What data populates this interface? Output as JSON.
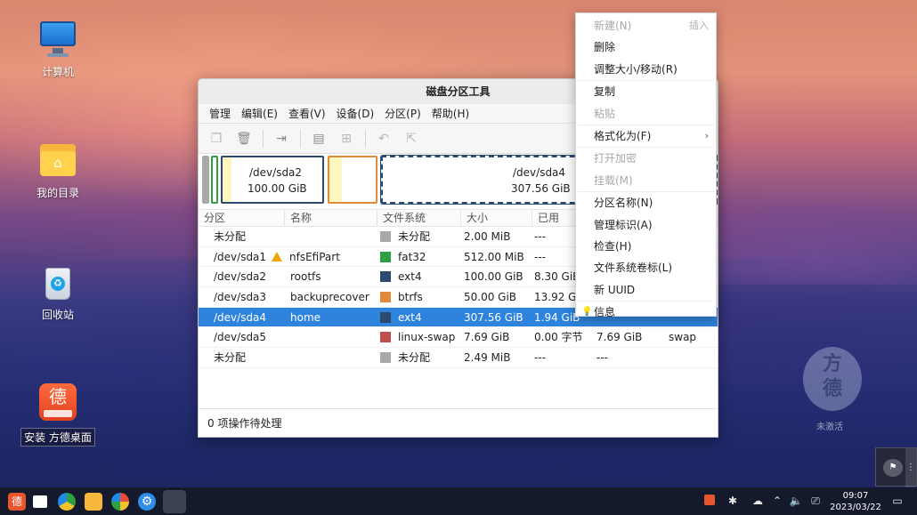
{
  "desktop": {
    "icons": [
      {
        "label": "计算机"
      },
      {
        "label": "我的目录"
      },
      {
        "label": "回收站"
      },
      {
        "label": "安装 方德桌面",
        "glyph": "德"
      }
    ],
    "watermark_text": "未激活"
  },
  "window": {
    "title": "磁盘分区工具",
    "menu": [
      "管理",
      "编辑(E)",
      "查看(V)",
      "设备(D)",
      "分区(P)",
      "帮助(H)"
    ],
    "toolbar_icons": [
      "new-partition-icon",
      "delete-icon",
      "resize-move-icon",
      "copy-icon",
      "paste-icon",
      "undo-icon",
      "apply-icon"
    ],
    "partition_map": [
      {
        "device": "/dev/sda2",
        "size": "100.00 GiB"
      },
      {
        "device": "/dev/sda4",
        "size": "307.56 GiB"
      }
    ],
    "table": {
      "headers": [
        "分区",
        "名称",
        "文件系统",
        "大小",
        "已用"
      ],
      "rows": [
        {
          "partition": "未分配",
          "name": "",
          "fs": "未分配",
          "fs_color": "#a8a8a8",
          "size": "2.00 MiB",
          "used": "---",
          "unused": "",
          "flags": ""
        },
        {
          "partition": "/dev/sda1",
          "name": "nfsEfiPart",
          "warn": true,
          "fs": "fat32",
          "fs_color": "#2ea043",
          "size": "512.00 MiB",
          "used": "---",
          "unused": "",
          "flags": ""
        },
        {
          "partition": "/dev/sda2",
          "name": "rootfs",
          "fs": "ext4",
          "fs_color": "#2a4a6e",
          "size": "100.00 GiB",
          "used": "8.30 GiB",
          "unused": "",
          "flags": ""
        },
        {
          "partition": "/dev/sda3",
          "name": "backuprecover",
          "fs": "btrfs",
          "fs_color": "#e08a3c",
          "size": "50.00 GiB",
          "used": "13.92 GiB",
          "unused": "",
          "flags": ""
        },
        {
          "partition": "/dev/sda4",
          "name": "home",
          "fs": "ext4",
          "fs_color": "#2a4a6e",
          "size": "307.56 GiB",
          "used": "1.94 GiB",
          "unused": "",
          "flags": "",
          "selected": true
        },
        {
          "partition": "/dev/sda5",
          "name": "",
          "fs": "linux-swap",
          "fs_color": "#c0504d",
          "size": "7.69 GiB",
          "used": "0.00 字节",
          "unused": "7.69 GiB",
          "flags": "swap"
        },
        {
          "partition": "未分配",
          "name": "",
          "fs": "未分配",
          "fs_color": "#a8a8a8",
          "size": "2.49 MiB",
          "used": "---",
          "unused": "---",
          "flags": ""
        }
      ]
    },
    "status": "0 项操作待处理"
  },
  "context_menu": {
    "items": [
      {
        "label": "新建(N)",
        "shortcut": "插入",
        "disabled": true
      },
      {
        "label": "删除",
        "disabled": false
      },
      {
        "label": "调整大小/移动(R)",
        "disabled": false
      },
      {
        "sep": true
      },
      {
        "label": "复制",
        "disabled": false
      },
      {
        "label": "粘贴",
        "disabled": true
      },
      {
        "sep": true
      },
      {
        "label": "格式化为(F)",
        "disabled": false,
        "submenu": true
      },
      {
        "sep": true
      },
      {
        "label": "打开加密",
        "disabled": true
      },
      {
        "label": "挂载(M)",
        "disabled": true
      },
      {
        "sep": true
      },
      {
        "label": "分区名称(N)",
        "disabled": false
      },
      {
        "label": "管理标识(A)",
        "disabled": false
      },
      {
        "label": "检查(H)",
        "disabled": false
      },
      {
        "label": "文件系统卷标(L)",
        "disabled": false
      },
      {
        "label": "新 UUID",
        "disabled": false
      },
      {
        "sep": true
      },
      {
        "label": "信息",
        "disabled": false,
        "icon": "bulb-icon"
      }
    ]
  },
  "taskbar": {
    "apps": [
      "fangde-launcher-icon",
      "multitask-icon",
      "browser-icon",
      "files-icon",
      "app-store-icon",
      "settings-icon",
      "disk-utility-icon"
    ],
    "clock": {
      "time": "09:07",
      "date": "2023/03/22"
    }
  }
}
